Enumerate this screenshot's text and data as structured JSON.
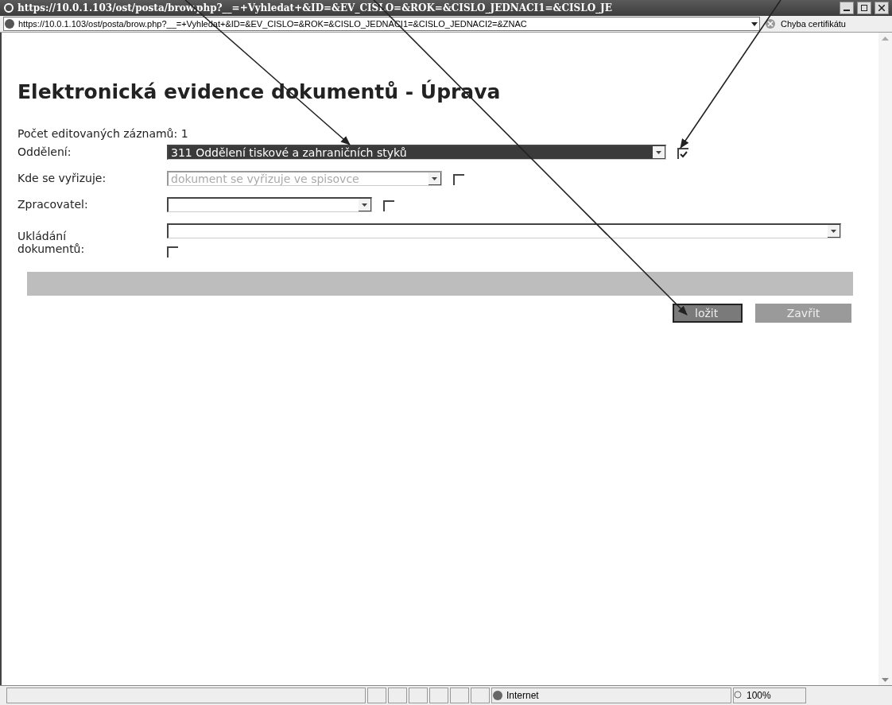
{
  "title_bar": {
    "title": "https://10.0.1.103/ost/posta/brow.php?__=+Vyhledat+&ID=&EV_CISLO=&ROK=&CISLO_JEDNACI1=&CISLO_JE"
  },
  "address_bar": {
    "url": "https://10.0.1.103/ost/posta/brow.php?__=+Vyhledat+&ID=&EV_CISLO=&ROK=&CISLO_JEDNACI1=&CISLO_JEDNACI2=&ZNAC",
    "certificate_error": "Chyba certifikátu"
  },
  "page": {
    "heading": "Elektronická evidence dokumentů - Úprava",
    "record_count": "Počet editovaných záznamů: 1",
    "fields": [
      {
        "label": "Oddělení:",
        "value": "311 Oddělení tiskové a zahraničních styků",
        "highlighted": true,
        "disabled": false,
        "checked": true,
        "kind": "inline"
      },
      {
        "label": "Kde se vyřizuje:",
        "value": "dokument se vyřizuje ve spisovce",
        "highlighted": false,
        "disabled": true,
        "checked": false,
        "kind": "inline"
      },
      {
        "label": "Zpracovatel:",
        "highlighted": false,
        "checked": false,
        "kind": "inline"
      },
      {
        "label": "Ukládání dokumentů:",
        "highlighted": false,
        "checked": false,
        "kind": "below"
      }
    ],
    "buttons": [
      {
        "label": "ložit",
        "kind": "primary"
      },
      {
        "label": "Zavřit",
        "kind": "secondary"
      }
    ]
  },
  "status_bar": {
    "zone": "Internet",
    "zoom": "100%"
  }
}
